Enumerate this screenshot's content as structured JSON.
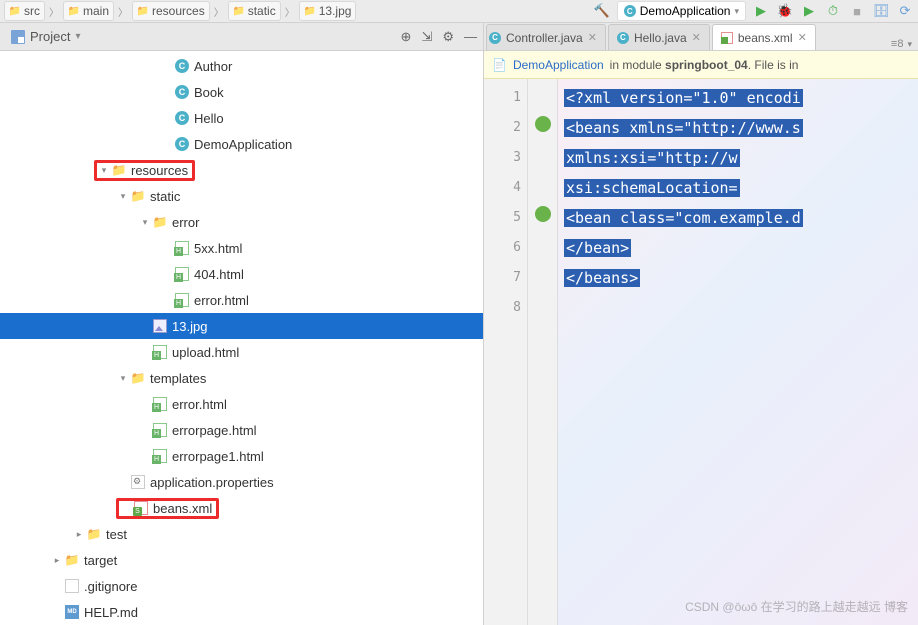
{
  "breadcrumb": [
    "src",
    "main",
    "resources",
    "static",
    "13.jpg"
  ],
  "run_config": "DemoApplication",
  "project_panel_label": "Project",
  "tree_indent": 22,
  "tree": [
    {
      "depth": 5,
      "icon": "class",
      "label": "Author",
      "interact": true
    },
    {
      "depth": 5,
      "icon": "class",
      "label": "Book",
      "interact": true
    },
    {
      "depth": 5,
      "icon": "class",
      "label": "Hello",
      "interact": true
    },
    {
      "depth": 5,
      "icon": "class-run",
      "label": "DemoApplication",
      "interact": true
    },
    {
      "depth": 2,
      "chevron": "down",
      "icon": "folder",
      "label": "resources",
      "interact": true,
      "red": true
    },
    {
      "depth": 3,
      "chevron": "down",
      "icon": "folder",
      "label": "static",
      "interact": true
    },
    {
      "depth": 4,
      "chevron": "down",
      "icon": "folder",
      "label": "error",
      "interact": true
    },
    {
      "depth": 5,
      "icon": "html",
      "label": "5xx.html",
      "interact": true
    },
    {
      "depth": 5,
      "icon": "html",
      "label": "404.html",
      "interact": true
    },
    {
      "depth": 5,
      "icon": "html",
      "label": "error.html",
      "interact": true
    },
    {
      "depth": 4,
      "icon": "img",
      "label": "13.jpg",
      "interact": true,
      "selected": true
    },
    {
      "depth": 4,
      "icon": "html",
      "label": "upload.html",
      "interact": true
    },
    {
      "depth": 3,
      "chevron": "down",
      "icon": "folder",
      "label": "templates",
      "interact": true
    },
    {
      "depth": 4,
      "icon": "html",
      "label": "error.html",
      "interact": true
    },
    {
      "depth": 4,
      "icon": "html",
      "label": "errorpage.html",
      "interact": true
    },
    {
      "depth": 4,
      "icon": "html",
      "label": "errorpage1.html",
      "interact": true
    },
    {
      "depth": 3,
      "icon": "prop",
      "label": "application.properties",
      "interact": true
    },
    {
      "depth": 3,
      "icon": "xml",
      "label": "beans.xml",
      "interact": true,
      "red": true
    },
    {
      "depth": 1,
      "chevron": "right",
      "icon": "folder",
      "label": "test",
      "interact": true
    },
    {
      "depth": 0,
      "chevron": "right",
      "icon": "folder-orange",
      "label": "target",
      "interact": true
    },
    {
      "depth": 0,
      "icon": "git",
      "label": ".gitignore",
      "interact": true
    },
    {
      "depth": 0,
      "icon": "md",
      "label": "HELP.md",
      "interact": true
    }
  ],
  "tabs": [
    {
      "icon": "class",
      "label": "Controller.java",
      "active": false,
      "trimmed": true
    },
    {
      "icon": "class",
      "label": "Hello.java",
      "active": false
    },
    {
      "icon": "xml",
      "label": "beans.xml",
      "active": true
    }
  ],
  "tabs_indicator": "≡8",
  "banner": {
    "link": "DemoApplication",
    "mid": " in module ",
    "bold": "springboot_04",
    "tail": ". File is in"
  },
  "code_lines": [
    "<?xml version=\"1.0\" encodi",
    "<beans xmlns=\"http://www.s",
    "       xmlns:xsi=\"http://w",
    "       xsi:schemaLocation=",
    "<bean class=\"com.example.d",
    "</bean>",
    "</beans>",
    ""
  ],
  "watermark": "CSDN @ōωō 在学习的路上越走越远 博客"
}
